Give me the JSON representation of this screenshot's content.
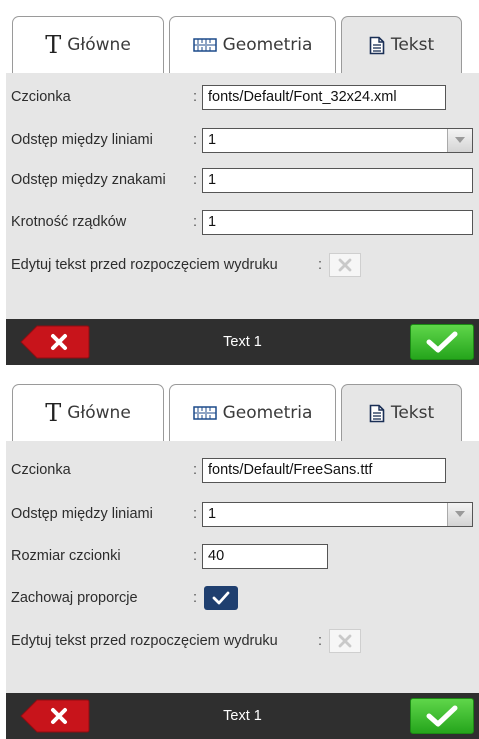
{
  "colors": {
    "active_tab": "#e6e6e6",
    "footer": "#2f2f2f",
    "ok_green": "#2db421",
    "cancel_red": "#c8141b",
    "checkbox_on": "#1f3f6f"
  },
  "dialog1": {
    "tabs": [
      {
        "label": "Główne",
        "icon": "text-t-icon"
      },
      {
        "label": "Geometria",
        "icon": "ruler-icon"
      },
      {
        "label": "Tekst",
        "icon": "document-icon",
        "active": true
      }
    ],
    "font_label": "Czcionka",
    "font_value": "fonts/Default/Font_32x24.xml",
    "line_spacing_label": "Odstęp między liniami",
    "line_spacing_value": "1",
    "char_spacing_label": "Odstęp między znakami",
    "char_spacing_value": "1",
    "line_multiplicity_label": "Krotność rządków",
    "line_multiplicity_value": "1",
    "edit_before_print_label": "Edytuj tekst przed rozpoczęciem wydruku",
    "edit_before_print_checked": false,
    "footer_title": "Text 1"
  },
  "dialog2": {
    "tabs": [
      {
        "label": "Główne",
        "icon": "text-t-icon"
      },
      {
        "label": "Geometria",
        "icon": "ruler-icon"
      },
      {
        "label": "Tekst",
        "icon": "document-icon",
        "active": true
      }
    ],
    "font_label": "Czcionka",
    "font_value": "fonts/Default/FreeSans.ttf",
    "line_spacing_label": "Odstęp między liniami",
    "line_spacing_value": "1",
    "font_size_label": "Rozmiar czcionki",
    "font_size_value": "40",
    "keep_proportions_label": "Zachowaj proporcje",
    "keep_proportions_checked": true,
    "edit_before_print_label": "Edytuj tekst przed rozpoczęciem wydruku",
    "edit_before_print_checked": false,
    "footer_title": "Text 1"
  },
  "colon": ":"
}
